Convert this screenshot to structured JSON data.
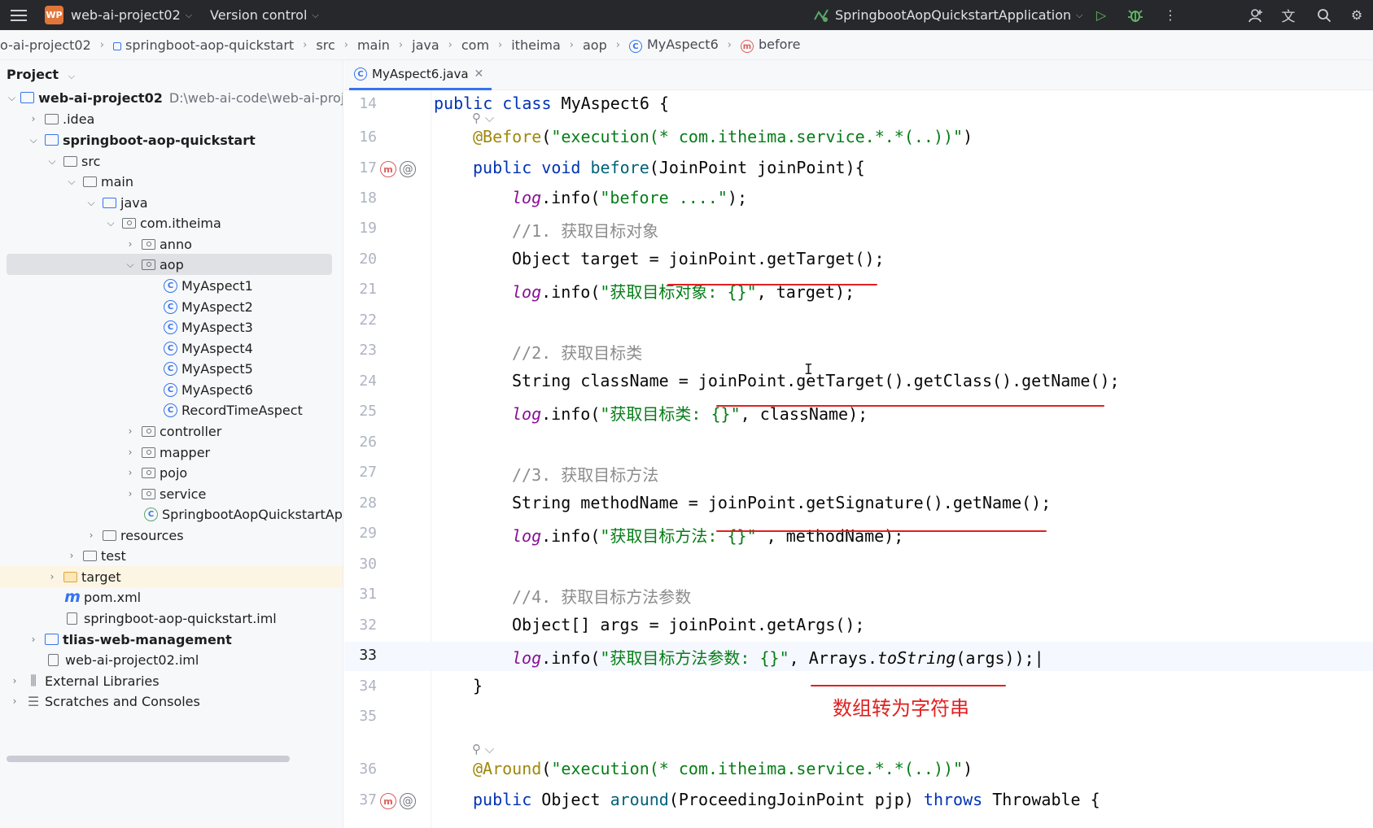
{
  "titlebar": {
    "badge": "WP",
    "project": "web-ai-project02",
    "vcs": "Version control",
    "run_config": "SpringbootAopQuickstartApplication"
  },
  "breadcrumb": [
    "o-ai-project02",
    "springboot-aop-quickstart",
    "src",
    "main",
    "java",
    "com",
    "itheima",
    "aop",
    "MyAspect6",
    "before"
  ],
  "project": {
    "header": "Project",
    "tree": [
      {
        "label": "web-ai-project02",
        "extra": "D:\\web-ai-code\\web-ai-proj"
      },
      {
        "label": ".idea"
      },
      {
        "label": "springboot-aop-quickstart"
      },
      {
        "label": "src"
      },
      {
        "label": "main"
      },
      {
        "label": "java"
      },
      {
        "label": "com.itheima"
      },
      {
        "label": "anno"
      },
      {
        "label": "aop"
      },
      {
        "label": "MyAspect1"
      },
      {
        "label": "MyAspect2"
      },
      {
        "label": "MyAspect3"
      },
      {
        "label": "MyAspect4"
      },
      {
        "label": "MyAspect5"
      },
      {
        "label": "MyAspect6"
      },
      {
        "label": "RecordTimeAspect"
      },
      {
        "label": "controller"
      },
      {
        "label": "mapper"
      },
      {
        "label": "pojo"
      },
      {
        "label": "service"
      },
      {
        "label": "SpringbootAopQuickstartApp"
      },
      {
        "label": "resources"
      },
      {
        "label": "test"
      },
      {
        "label": "target"
      },
      {
        "label": "pom.xml"
      },
      {
        "label": "springboot-aop-quickstart.iml"
      },
      {
        "label": "tlias-web-management"
      },
      {
        "label": "web-ai-project02.iml"
      },
      {
        "label": "External Libraries"
      },
      {
        "label": "Scratches and Consoles"
      }
    ]
  },
  "editor": {
    "tab": "MyAspect6.java",
    "lines": [
      {
        "n": "14",
        "code": "public class MyAspect6 {"
      },
      {
        "n": "16",
        "code": "@Before(\"execution(* com.itheima.service.*.*(..))\")"
      },
      {
        "n": "17",
        "code": "public void before(JoinPoint joinPoint){"
      },
      {
        "n": "18",
        "code": "log.info(\"before ....\");"
      },
      {
        "n": "19",
        "code": "//1. 获取目标对象"
      },
      {
        "n": "20",
        "code": "Object target = joinPoint.getTarget();"
      },
      {
        "n": "21",
        "code": "log.info(\"获取目标对象: {}\", target);"
      },
      {
        "n": "22",
        "code": ""
      },
      {
        "n": "23",
        "code": "//2. 获取目标类"
      },
      {
        "n": "24",
        "code": "String className = joinPoint.getTarget().getClass().getName();"
      },
      {
        "n": "25",
        "code": "log.info(\"获取目标类: {}\", className);"
      },
      {
        "n": "26",
        "code": ""
      },
      {
        "n": "27",
        "code": "//3. 获取目标方法"
      },
      {
        "n": "28",
        "code": "String methodName = joinPoint.getSignature().getName();"
      },
      {
        "n": "29",
        "code": "log.info(\"获取目标方法: {}\" , methodName);"
      },
      {
        "n": "30",
        "code": ""
      },
      {
        "n": "31",
        "code": "//4. 获取目标方法参数"
      },
      {
        "n": "32",
        "code": "Object[] args = joinPoint.getArgs();"
      },
      {
        "n": "33",
        "code": "log.info(\"获取目标方法参数: {}\", Arrays.toString(args));"
      },
      {
        "n": "34",
        "code": "}"
      },
      {
        "n": "35",
        "code": ""
      },
      {
        "n": "36",
        "code": "@Around(\"execution(* com.itheima.service.*.*(..))\")"
      },
      {
        "n": "37",
        "code": "public Object around(ProceedingJoinPoint pjp) throws Throwable {"
      }
    ],
    "annotation": "数组转为字符串"
  },
  "colors": {
    "keyword": "#0033b3",
    "string": "#067d17",
    "annotation": "#9e880d",
    "comment": "#8c8c8c",
    "static_field": "#871094",
    "underline": "#e02020",
    "accent": "#3574f0"
  }
}
